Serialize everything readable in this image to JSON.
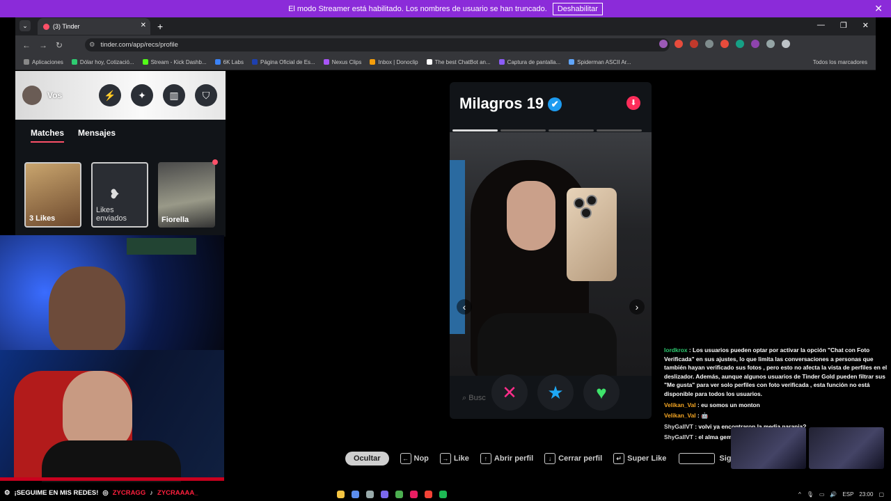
{
  "banner": {
    "message": "El modo Streamer está habilitado. Los nombres de usuario se han truncado.",
    "button": "Deshabilitar",
    "close": "✕"
  },
  "browser": {
    "tab_title": "(3) Tinder",
    "tab_close": "✕",
    "new_tab": "+",
    "url": "tinder.com/app/recs/profile",
    "bookmarks": [
      {
        "label": "Aplicaciones",
        "color": "#888888"
      },
      {
        "label": "Dólar hoy, Cotizació...",
        "color": "#2ecc71"
      },
      {
        "label": "Stream - Kick Dashb...",
        "color": "#53fc18"
      },
      {
        "label": "6K Labs",
        "color": "#3b82f6"
      },
      {
        "label": "Página Oficial de Es...",
        "color": "#1e40af"
      },
      {
        "label": "Nexus Clips",
        "color": "#a855f7"
      },
      {
        "label": "Inbox | Donoclip",
        "color": "#f59e0b"
      },
      {
        "label": "The best ChatBot an...",
        "color": "#ffffff"
      },
      {
        "label": "Captura de pantalla...",
        "color": "#8b5cf6"
      },
      {
        "label": "Spiderman ASCII Ar...",
        "color": "#60a5fa"
      }
    ],
    "all_bookmarks": "Todos los marcadores"
  },
  "sidebar": {
    "user_label": "Vos",
    "tabs": [
      "Matches",
      "Mensajes"
    ],
    "cards": [
      {
        "label": "3 Likes"
      },
      {
        "label": "Likes enviados"
      },
      {
        "label": "Fiorella"
      }
    ]
  },
  "profile": {
    "name": "Milagros",
    "age": "19",
    "verified_icon": "✔",
    "search_placeholder": "Busc"
  },
  "actions": {
    "nope": "✕",
    "super_like": "★",
    "like": "♥"
  },
  "shortcuts": {
    "hide": "Ocultar",
    "items": [
      {
        "key": "←",
        "label": "Nop"
      },
      {
        "key": "→",
        "label": "Like"
      },
      {
        "key": "↑",
        "label": "Abrir perfil"
      },
      {
        "key": "↓",
        "label": "Cerrar perfil"
      },
      {
        "key": "↵",
        "label": "Super Like"
      }
    ],
    "next": "Siguie"
  },
  "chat": [
    {
      "user": "lordkrox",
      "text": "Los usuarios pueden optar por activar la opción \"Chat con Foto Verificada\" en sus ajustes, lo que limita las conversaciones a personas que también hayan verificado sus fotos , pero esto no afecta la vista de perfiles en el deslizador. Además, aunque algunos usuarios de Tinder Gold pueden filtrar sus \"Me gusta\" para ver solo perfiles con foto verificada , esta función no está disponible para todos los usuarios."
    },
    {
      "user": "Velikan_Val",
      "text": "eu somos un monton"
    },
    {
      "user": "Velikan_Val",
      "text": "🤖"
    },
    {
      "user": "ShyGallVT",
      "text": "volvi ya encontraron la media naranja?"
    },
    {
      "user": "ShyGallVT",
      "text": "el alma gemela"
    }
  ],
  "stream": {
    "socials_text": "¡SEGUIME EN MIS REDES!",
    "handle1": "ZYCRAGG",
    "handle2": "ZYCRAAAA_"
  },
  "taskbar": {
    "lang": "ESP",
    "time": "23:00"
  },
  "colors": {
    "banner": "#8b2bd9",
    "tinder_accent": "#fd5068",
    "like_green": "#3fe36b",
    "super_blue": "#1ea7f4",
    "nope_pink": "#fd2d8a"
  }
}
